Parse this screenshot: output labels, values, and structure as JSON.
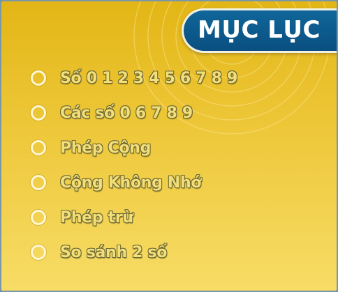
{
  "colors": {
    "background_top": "#e3b616",
    "background_bottom": "#f7dc66",
    "banner": "#0a5a8c",
    "label_fill": "#f3df79",
    "label_outline": "#6f6b37",
    "bullet": "#fff6d2"
  },
  "header": {
    "title": "MỤC LỤC"
  },
  "menu": {
    "items": [
      {
        "label": "Số 0 1 2 3 4 5 6 7 8 9",
        "icon": "circle-bullet-icon"
      },
      {
        "label": "Các số 0 6 7 8 9",
        "icon": "circle-bullet-icon"
      },
      {
        "label": "Phép Cộng",
        "icon": "circle-bullet-icon"
      },
      {
        "label": "Cộng Không Nhớ",
        "icon": "circle-bullet-icon"
      },
      {
        "label": "Phép trừ",
        "icon": "circle-bullet-icon"
      },
      {
        "label": "So sánh 2 số",
        "icon": "circle-bullet-icon"
      }
    ]
  }
}
